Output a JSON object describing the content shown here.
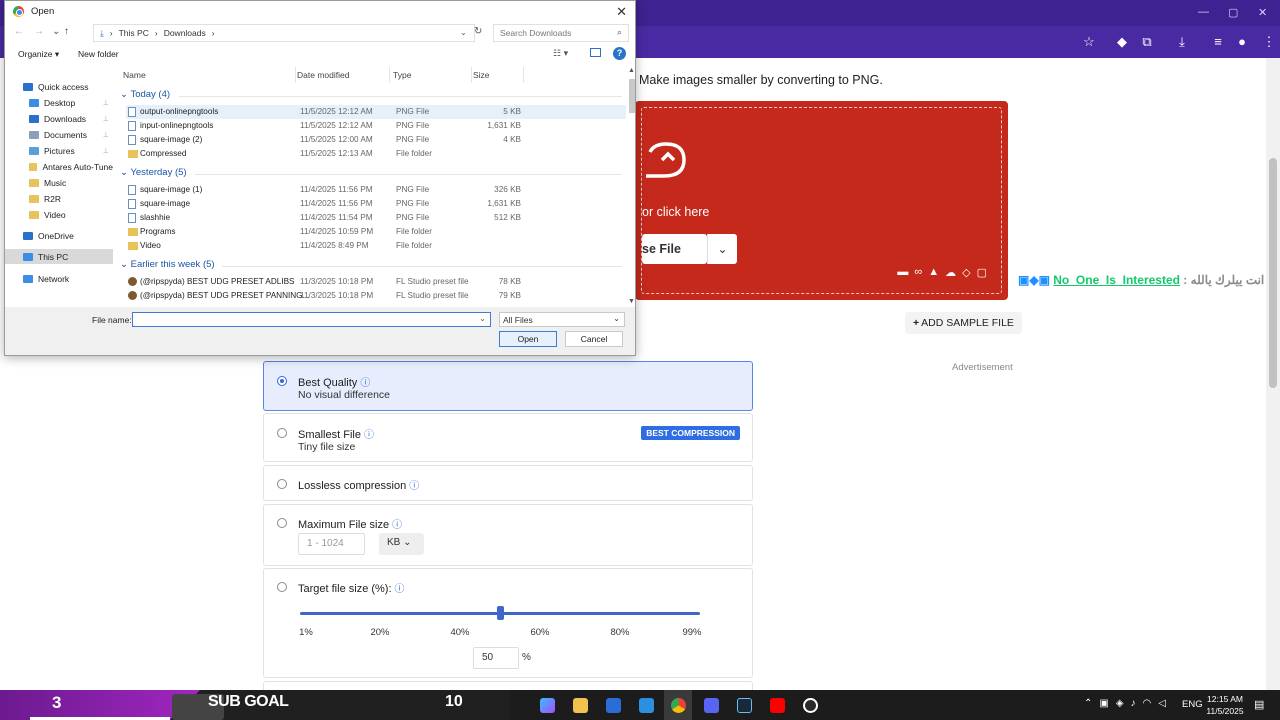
{
  "browser": {
    "subtitle": "Make images smaller by converting to PNG.",
    "dropzone": {
      "click_text": "or click here",
      "choose_file_label": "se File"
    },
    "stream_overlay": {
      "user": "No_One_Is_Interested",
      "message": " : انت ييلرك يالله"
    },
    "add_sample_label": "ADD SAMPLE FILE",
    "ad_label": "Advertisement",
    "options": {
      "best_quality": {
        "title": "Best Quality",
        "sub": "No visual difference",
        "selected": true
      },
      "smallest_file": {
        "title": "Smallest File",
        "sub": "Tiny file size",
        "badge": "BEST COMPRESSION"
      },
      "lossless": {
        "title": "Lossless compression"
      },
      "max_file_size": {
        "title": "Maximum File size",
        "placeholder": "1 - 1024",
        "unit": "KB"
      },
      "target_size": {
        "title": "Target file size (%):",
        "ticks": [
          "1%",
          "20%",
          "40%",
          "60%",
          "80%",
          "99%"
        ],
        "value": "50",
        "value_fraction": 0.5,
        "unit": "%"
      }
    }
  },
  "dialog": {
    "title": "Open",
    "path": [
      "This PC",
      "Downloads"
    ],
    "search_placeholder": "Search Downloads",
    "organize_label": "Organize",
    "new_folder_label": "New folder",
    "nav": [
      {
        "label": "Quick access",
        "icon": "star-icon"
      },
      {
        "label": "Desktop",
        "icon": "desktop-icon",
        "pinned": true
      },
      {
        "label": "Downloads",
        "icon": "download-icon",
        "pinned": true
      },
      {
        "label": "Documents",
        "icon": "documents-icon",
        "pinned": true
      },
      {
        "label": "Pictures",
        "icon": "pictures-icon",
        "pinned": true
      },
      {
        "label": "Antares Auto-Tune",
        "icon": "folder-icon"
      },
      {
        "label": "Music",
        "icon": "folder-icon"
      },
      {
        "label": "R2R",
        "icon": "folder-icon"
      },
      {
        "label": "Video",
        "icon": "folder-icon"
      },
      {
        "label": "OneDrive",
        "icon": "cloud-icon"
      },
      {
        "label": "This PC",
        "icon": "computer-icon",
        "selected": true
      },
      {
        "label": "Network",
        "icon": "network-icon"
      }
    ],
    "columns": {
      "name": "Name",
      "date": "Date modified",
      "type": "Type",
      "size": "Size"
    },
    "groups": [
      {
        "label": "Today (4)",
        "files": [
          {
            "name": "output-onlinepngtools",
            "date": "11/5/2025 12:12 AM",
            "type": "PNG File",
            "size": "5 KB",
            "icon": "png"
          },
          {
            "name": "input-onlinepngtools",
            "date": "11/5/2025 12:12 AM",
            "type": "PNG File",
            "size": "1,631 KB",
            "icon": "png"
          },
          {
            "name": "square-image (2)",
            "date": "11/5/2025 12:00 AM",
            "type": "PNG File",
            "size": "4 KB",
            "icon": "png"
          },
          {
            "name": "Compressed",
            "date": "11/5/2025 12:13 AM",
            "type": "File folder",
            "size": "",
            "icon": "folder"
          }
        ]
      },
      {
        "label": "Yesterday (5)",
        "files": [
          {
            "name": "square-image (1)",
            "date": "11/4/2025 11:56 PM",
            "type": "PNG File",
            "size": "326 KB",
            "icon": "png"
          },
          {
            "name": "square-image",
            "date": "11/4/2025 11:56 PM",
            "type": "PNG File",
            "size": "1,631 KB",
            "icon": "png"
          },
          {
            "name": "slashhie",
            "date": "11/4/2025 11:54 PM",
            "type": "PNG File",
            "size": "512 KB",
            "icon": "png"
          },
          {
            "name": "Programs",
            "date": "11/4/2025 10:59 PM",
            "type": "File folder",
            "size": "",
            "icon": "folder"
          },
          {
            "name": "Video",
            "date": "11/4/2025 8:49 PM",
            "type": "File folder",
            "size": "",
            "icon": "folder"
          }
        ]
      },
      {
        "label": "Earlier this week (5)",
        "files": [
          {
            "name": "(@ripspyda) BEST UDG PRESET ADLIBS",
            "date": "11/3/2025 10:18 PM",
            "type": "FL Studio preset file",
            "size": "78 KB",
            "icon": "fl"
          },
          {
            "name": "(@ripspyda) BEST UDG PRESET PANNING...",
            "date": "11/3/2025 10:18 PM",
            "type": "FL Studio preset file",
            "size": "79 KB",
            "icon": "fl"
          }
        ]
      }
    ],
    "file_name_label": "File name:",
    "file_name_value": "",
    "file_type": "All Files",
    "open_label": "Open",
    "cancel_label": "Cancel"
  },
  "taskbar": {
    "sub_count": "3",
    "sub_goal_label": "SUB GOAL",
    "sub_goal_target": "10",
    "language": "ENG",
    "time": "12:15 AM",
    "date": "11/5/2025"
  }
}
